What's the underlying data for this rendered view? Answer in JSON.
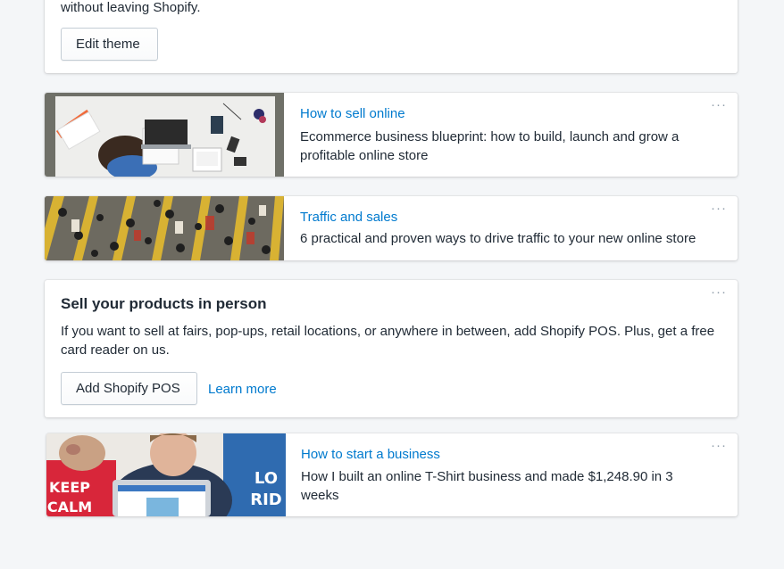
{
  "theme_card": {
    "description_tail": "without leaving Shopify.",
    "edit_button": "Edit theme"
  },
  "articles": [
    {
      "title": "How to sell online",
      "description": "Ecommerce business blueprint: how to build, launch and grow a profitable online store"
    },
    {
      "title": "Traffic and sales",
      "description": "6 practical and proven ways to drive traffic to your new online store"
    },
    {
      "title": "How to start a business",
      "description": "How I built an online T-Shirt business and made $1,248.90 in 3 weeks"
    }
  ],
  "pos_card": {
    "title": "Sell your products in person",
    "description": "If you want to sell at fairs, pop-ups, retail locations, or anywhere in between, add Shopify POS. Plus, get a free card reader on us.",
    "primary_button": "Add Shopify POS",
    "learn_more": "Learn more"
  },
  "more_actions_icon": "···",
  "photo_text": {
    "shirt_left": "KEEP CALM",
    "shirt_right": "LO RID"
  }
}
